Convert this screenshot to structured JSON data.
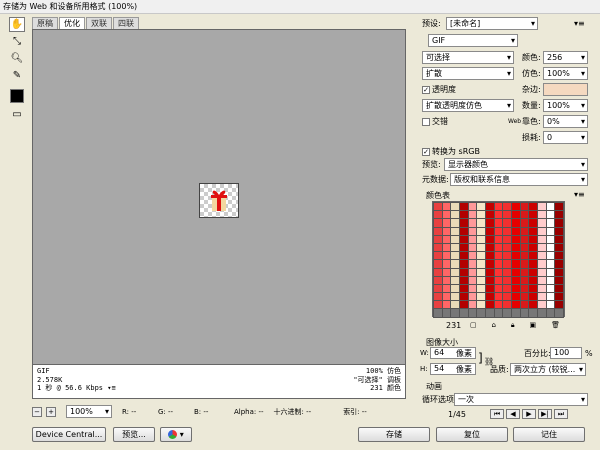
{
  "window": {
    "title": "存储为 Web 和设备所用格式 (100%)"
  },
  "tools": {
    "hand": "hand-tool",
    "slice": "slice-select-tool",
    "zoom": "zoom-tool",
    "eyedropper": "eyedropper-tool"
  },
  "tabs": [
    {
      "label": "原稿"
    },
    {
      "label": "优化"
    },
    {
      "label": "双联"
    },
    {
      "label": "四联"
    }
  ],
  "info": {
    "format": "GIF",
    "size": "2.578K",
    "speed": "1 秒 @ 56.6 Kbps",
    "dither": "100% 仿色",
    "palette": "\"可选择\" 调板",
    "colors": "231 颜色"
  },
  "status": {
    "zoom": "100%",
    "r": "R: --",
    "g": "G: --",
    "b": "B: --",
    "alpha": "Alpha: --",
    "hex": "十六进制: --",
    "index": "索引: --"
  },
  "bottom": {
    "device_central": "Device Central...",
    "preview": "预览...",
    "save": "存储",
    "reset": "复位",
    "remember": "记住"
  },
  "settings": {
    "preset_label": "预设:",
    "preset_value": "[未命名]",
    "format_value": "GIF",
    "reduction_value": "可选择",
    "colors_label": "颜色:",
    "colors_value": "256",
    "dither_algo_value": "扩散",
    "dither_label": "仿色:",
    "dither_value": "100%",
    "transparency_label": "透明度",
    "matte_label": "杂边:",
    "trans_dither_value": "扩散透明度仿色",
    "amount_label": "数量:",
    "amount_value": "100%",
    "interlace_label": "交错",
    "websnap_prefix": "Web",
    "websnap_label": "靠色:",
    "websnap_value": "0%",
    "lossy_label": "损耗:",
    "lossy_value": "0",
    "convert_srgb_label": "转换为 sRGB",
    "preview_label": "预览:",
    "preview_value": "显示器颜色",
    "metadata_label": "元数据:",
    "metadata_value": "版权和联系信息"
  },
  "color_table": {
    "title": "颜色表",
    "count": "231",
    "colors": [
      "#ffffff",
      "#cc0000",
      "#e60000",
      "#ff3333",
      "#f5e6c8",
      "#b30000",
      "#ff6666",
      "#990000",
      "#ffcccc",
      "#d91a1a",
      "#f23030",
      "#c40000",
      "#ff9999",
      "#eadbb8",
      "#e84040"
    ]
  },
  "image_size": {
    "title": "图像大小",
    "w_label": "W:",
    "w_value": "64",
    "h_label": "H:",
    "h_value": "54",
    "unit": "像素",
    "percent_label": "百分比:",
    "percent_value": "100",
    "percent_unit": "%",
    "quality_label": "品质:",
    "quality_value": "两次立方 (较锐..."
  },
  "animation": {
    "title": "动画",
    "loop_label": "循环选项:",
    "loop_value": "一次",
    "frame": "1/45"
  }
}
